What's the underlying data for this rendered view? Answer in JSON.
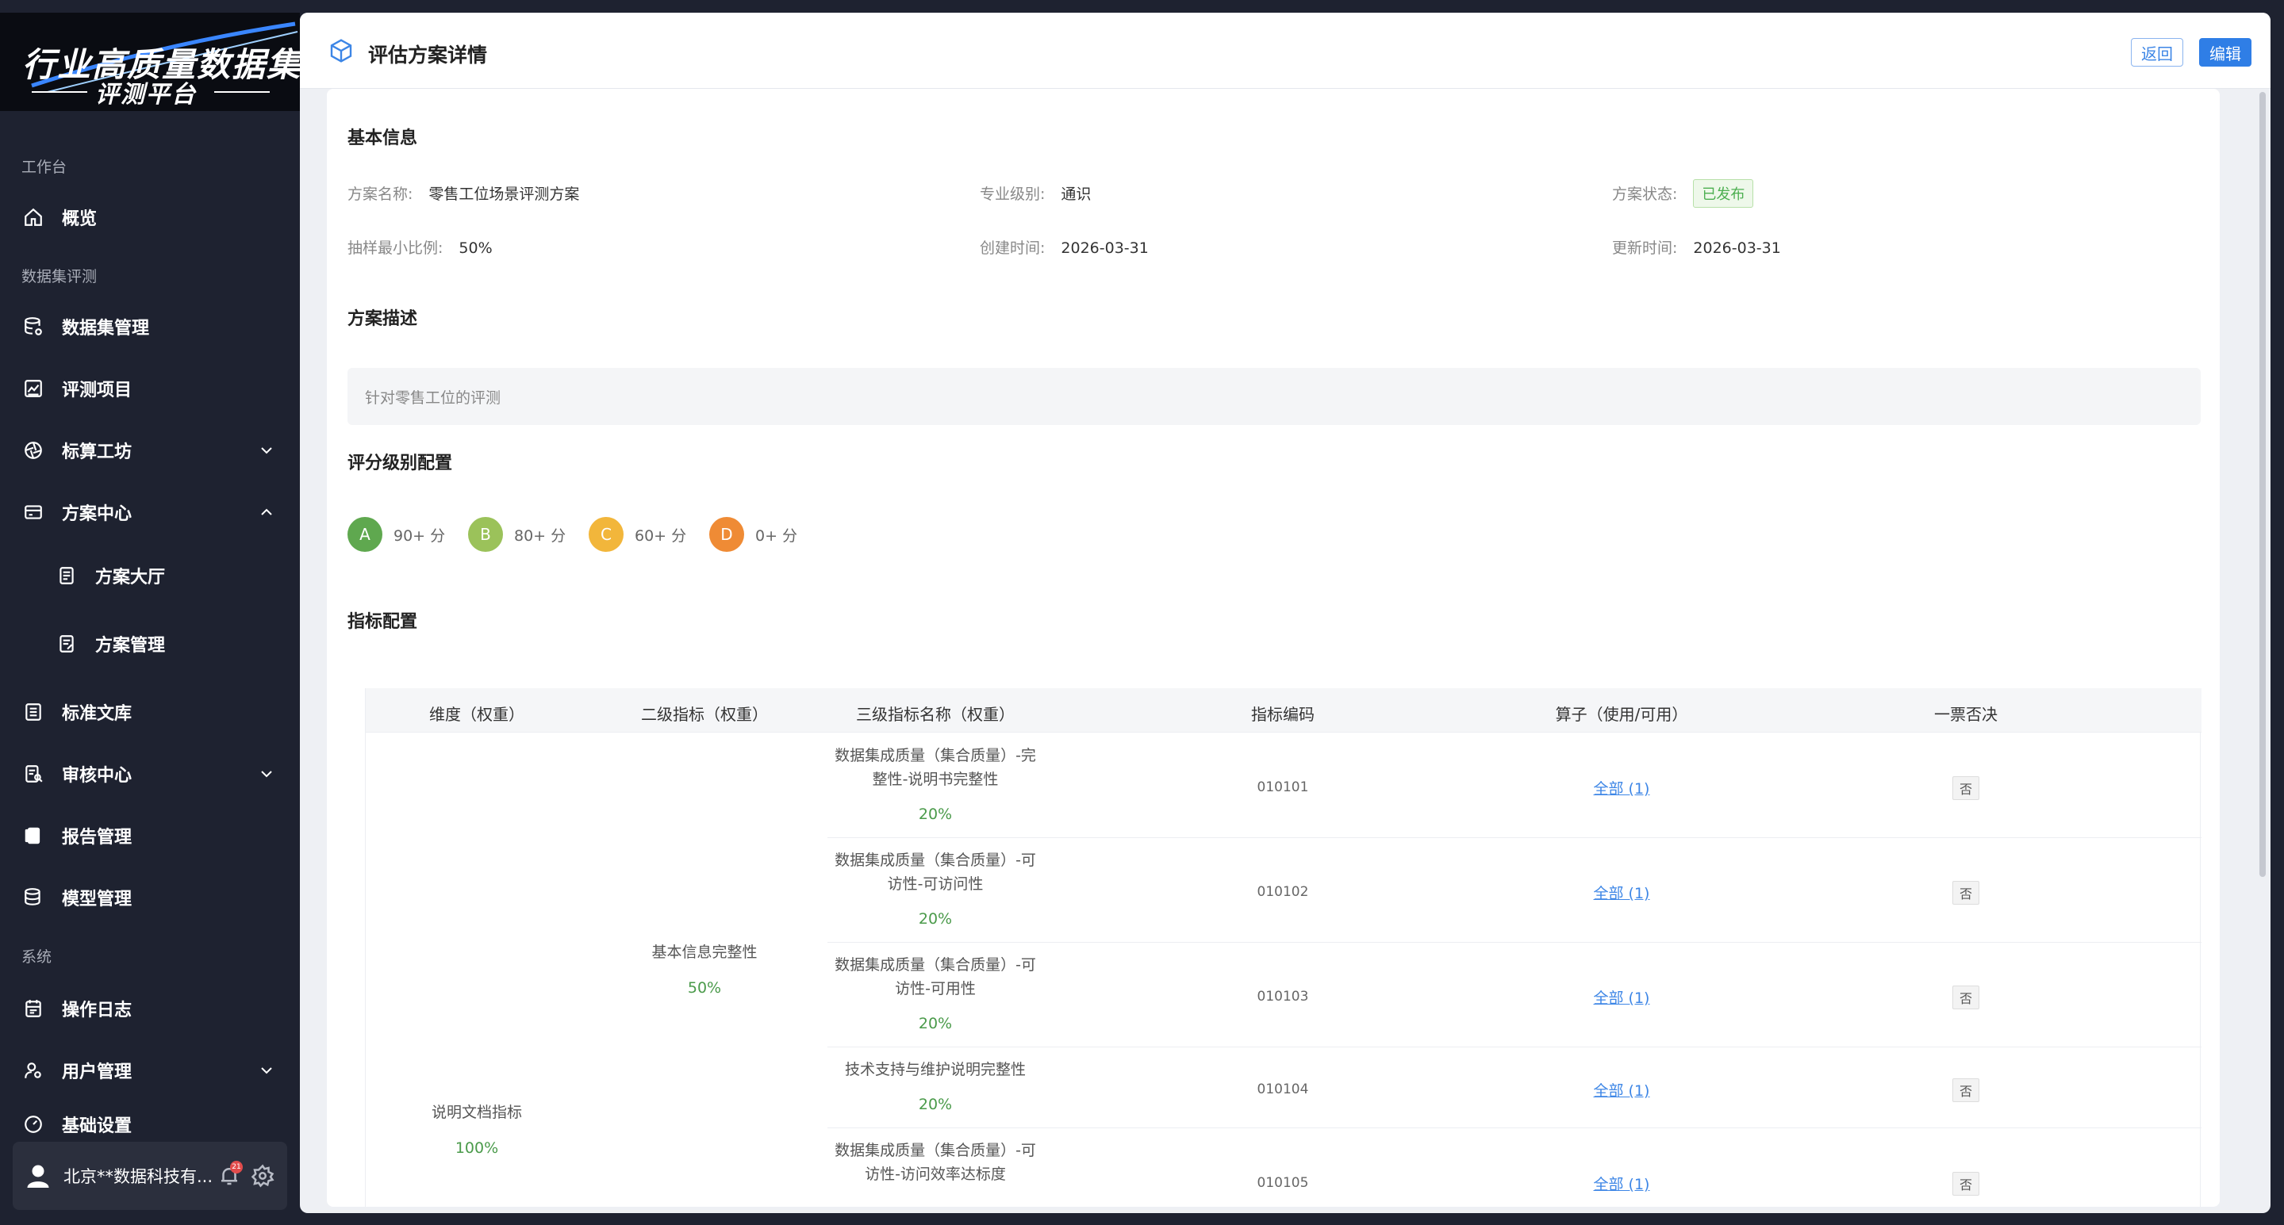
{
  "logo": {
    "title": "行业高质量数据集",
    "subtitle": "评测平台"
  },
  "sidebar": {
    "sections": {
      "workspace": "工作台",
      "dataset_eval": "数据集评测",
      "system": "系统"
    },
    "items": {
      "overview": "概览",
      "dataset_mgmt": "数据集管理",
      "eval_project": "评测项目",
      "operator_workshop": "标算工坊",
      "plan_center": "方案中心",
      "plan_hall": "方案大厅",
      "plan_mgmt": "方案管理",
      "standard_lib": "标准文库",
      "review_center": "审核中心",
      "report_mgmt": "报告管理",
      "model_mgmt": "模型管理",
      "op_log": "操作日志",
      "user_mgmt": "用户管理",
      "base_settings": "基础设置"
    },
    "user": {
      "name": "北京**数据科技有...",
      "badge": "21"
    }
  },
  "header": {
    "title": "评估方案详情",
    "back_label": "返回",
    "edit_label": "编辑"
  },
  "basic_info": {
    "section_title": "基本信息",
    "plan_name_label": "方案名称:",
    "plan_name": "零售工位场景评测方案",
    "level_label": "专业级别:",
    "level": "通识",
    "status_label": "方案状态:",
    "status": "已发布",
    "sample_label": "抽样最小比例:",
    "sample": "50%",
    "created_label": "创建时间:",
    "created": "2026-03-31",
    "updated_label": "更新时间:",
    "updated": "2026-03-31"
  },
  "description": {
    "section_title": "方案描述",
    "text": "针对零售工位的评测"
  },
  "grading": {
    "section_title": "评分级别配置",
    "grades": [
      {
        "letter": "A",
        "text": "90+ 分",
        "color": "#5fa84f"
      },
      {
        "letter": "B",
        "text": "80+ 分",
        "color": "#9bc25a"
      },
      {
        "letter": "C",
        "text": "60+ 分",
        "color": "#f2b63b"
      },
      {
        "letter": "D",
        "text": "0+ 分",
        "color": "#ef8b35"
      }
    ]
  },
  "indicators": {
    "section_title": "指标配置",
    "headers": [
      "维度（权重）",
      "二级指标（权重）",
      "三级指标名称（权重）",
      "指标编码",
      "算子（使用/可用）",
      "一票否决"
    ],
    "dimension": {
      "name": "说明文档指标",
      "weight": "100%"
    },
    "level2": {
      "name": "基本信息完整性",
      "weight": "50%"
    },
    "rows": [
      {
        "name_line1": "数据集成质量（集合质量）-完",
        "name_line2": "整性-说明书完整性",
        "weight": "20%",
        "code": "010101",
        "operator": "全部 (1)",
        "veto": "否"
      },
      {
        "name_line1": "数据集成质量（集合质量）-可",
        "name_line2": "访性-可访问性",
        "weight": "20%",
        "code": "010102",
        "operator": "全部 (1)",
        "veto": "否"
      },
      {
        "name_line1": "数据集成质量（集合质量）-可",
        "name_line2": "访性-可用性",
        "weight": "20%",
        "code": "010103",
        "operator": "全部 (1)",
        "veto": "否"
      },
      {
        "name_line1": "技术支持与维护说明完整性",
        "name_line2": "",
        "weight": "20%",
        "code": "010104",
        "operator": "全部 (1)",
        "veto": "否"
      },
      {
        "name_line1": "数据集成质量（集合质量）-可",
        "name_line2": "访性-访问效率达标度",
        "weight": "",
        "code": "010105",
        "operator": "全部 (1)",
        "veto": "否"
      }
    ]
  }
}
